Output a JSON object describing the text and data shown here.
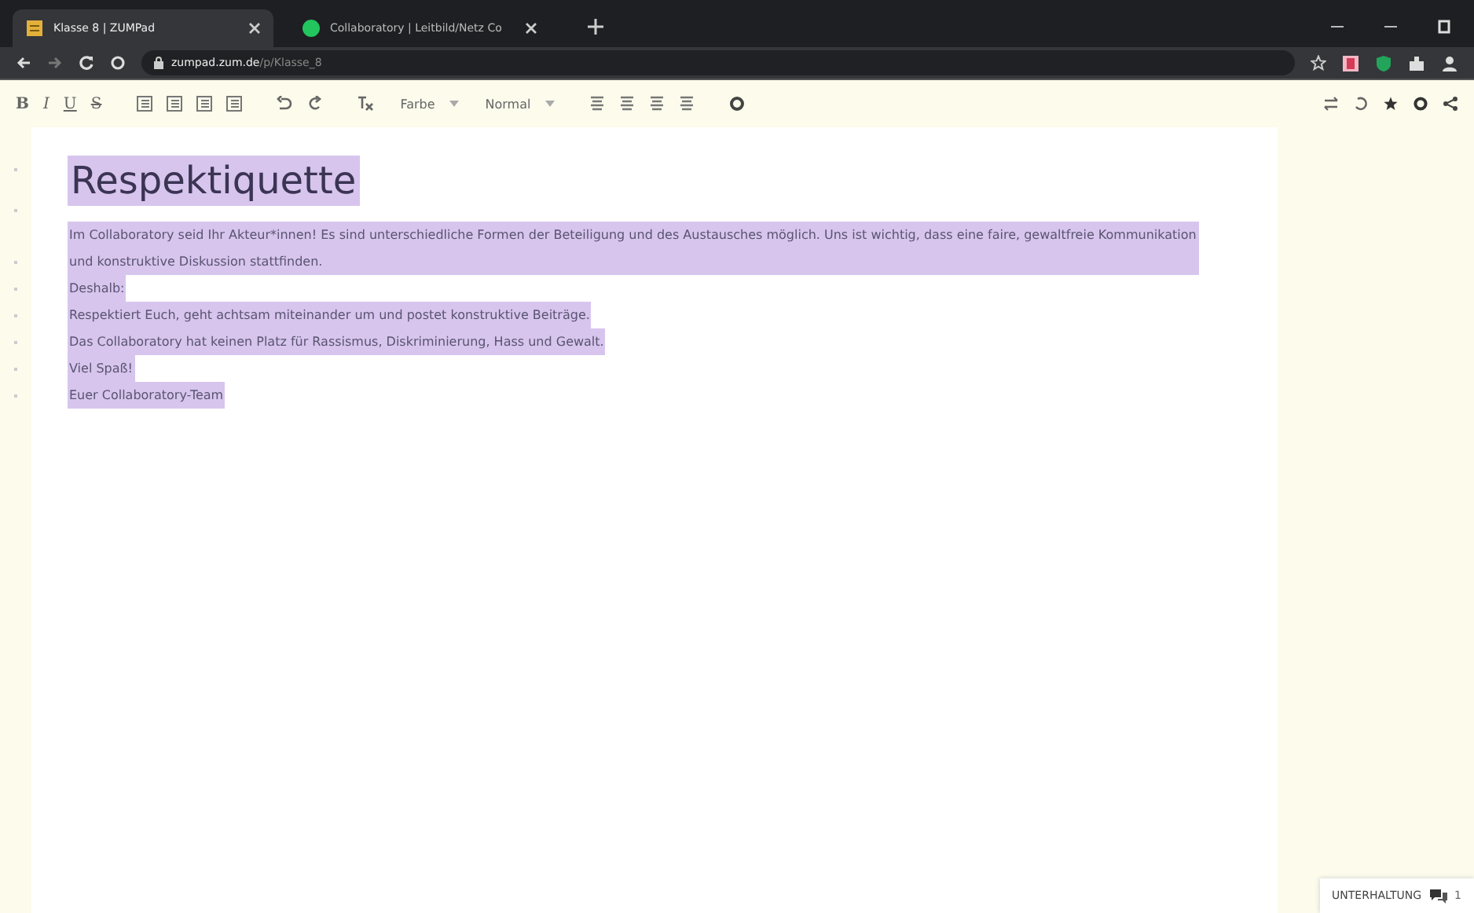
{
  "browser": {
    "tabs": [
      {
        "title": "Klasse 8 | ZUMPad",
        "selected": true,
        "kind": "pad"
      },
      {
        "title": "Collaboratory | Leitbild/Netz Co",
        "selected": false,
        "kind": "dot"
      }
    ],
    "url": {
      "host": "zumpad.zum.de",
      "path": "/p/Klasse_8"
    }
  },
  "toolbar": {
    "format_buttons": [
      "B",
      "I",
      "U",
      "S"
    ],
    "color_label": "Farbe",
    "style_label": "Normal"
  },
  "document": {
    "highlighted": true,
    "title": "Respektiquette",
    "paragraphs": [
      "Im Collaboratory seid Ihr Akteur*innen! Es sind unterschiedliche Formen der Beteiligung und des Austausches möglich. Uns ist wichtig, dass eine faire, gewaltfreie Kommunikation und konstruktive Diskussion stattfinden.",
      "Deshalb:",
      "Respektiert Euch, geht achtsam miteinander um und postet konstruktive Beiträge.",
      "Das Collaboratory hat keinen Platz für Rassismus, Diskriminierung, Hass und Gewalt.",
      "Viel Spaß!",
      "Euer Collaboratory-Team"
    ]
  },
  "chat": {
    "label": "UNTERHALTUNG",
    "count": "1"
  }
}
